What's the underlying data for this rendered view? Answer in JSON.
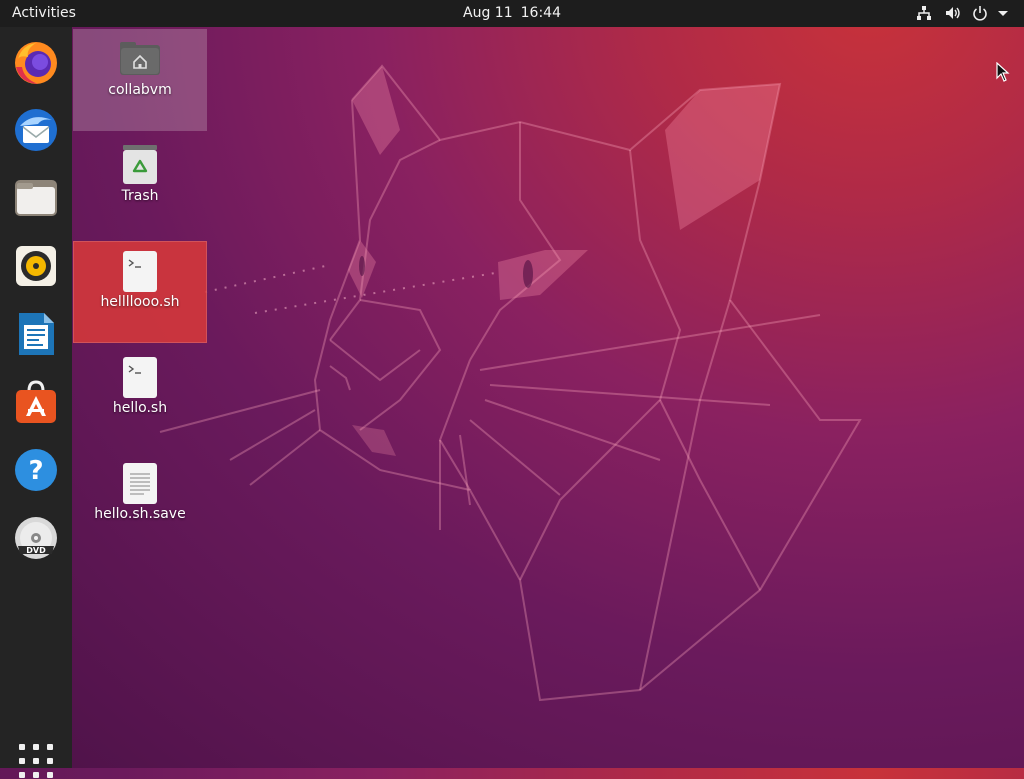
{
  "topbar": {
    "activities_label": "Activities",
    "date": "Aug 11",
    "time": "16:44",
    "tray_icons": [
      "network-icon",
      "volume-icon",
      "power-icon",
      "menu-arrow-icon"
    ]
  },
  "dock": {
    "apps": [
      {
        "name": "Firefox",
        "icon": "firefox-icon"
      },
      {
        "name": "Thunderbird",
        "icon": "thunderbird-icon"
      },
      {
        "name": "Files",
        "icon": "files-icon"
      },
      {
        "name": "Rhythmbox",
        "icon": "rhythmbox-icon"
      },
      {
        "name": "LibreOffice Writer",
        "icon": "writer-icon"
      },
      {
        "name": "Ubuntu Software",
        "icon": "software-icon"
      },
      {
        "name": "Help",
        "icon": "help-icon"
      },
      {
        "name": "DVD",
        "icon": "dvd-icon"
      }
    ],
    "show_apps_icon": "apps-grid-icon"
  },
  "desktop": {
    "items": [
      {
        "label": "collabvm",
        "icon": "home-folder-icon",
        "state": "selected-light"
      },
      {
        "label": "Trash",
        "icon": "trash-icon",
        "state": "normal"
      },
      {
        "label": "hellllooo.sh",
        "icon": "script-file-icon",
        "state": "selected-red"
      },
      {
        "label": "hello.sh",
        "icon": "script-file-icon",
        "state": "normal"
      },
      {
        "label": "hello.sh.save",
        "icon": "text-file-icon",
        "state": "normal"
      }
    ]
  },
  "colors": {
    "topbar_bg": "#1d1d1d",
    "dock_bg": "#242424",
    "selection_red": "#d6383a",
    "wallpaper_top": "#c8323a",
    "wallpaper_bottom": "#4d1248"
  }
}
